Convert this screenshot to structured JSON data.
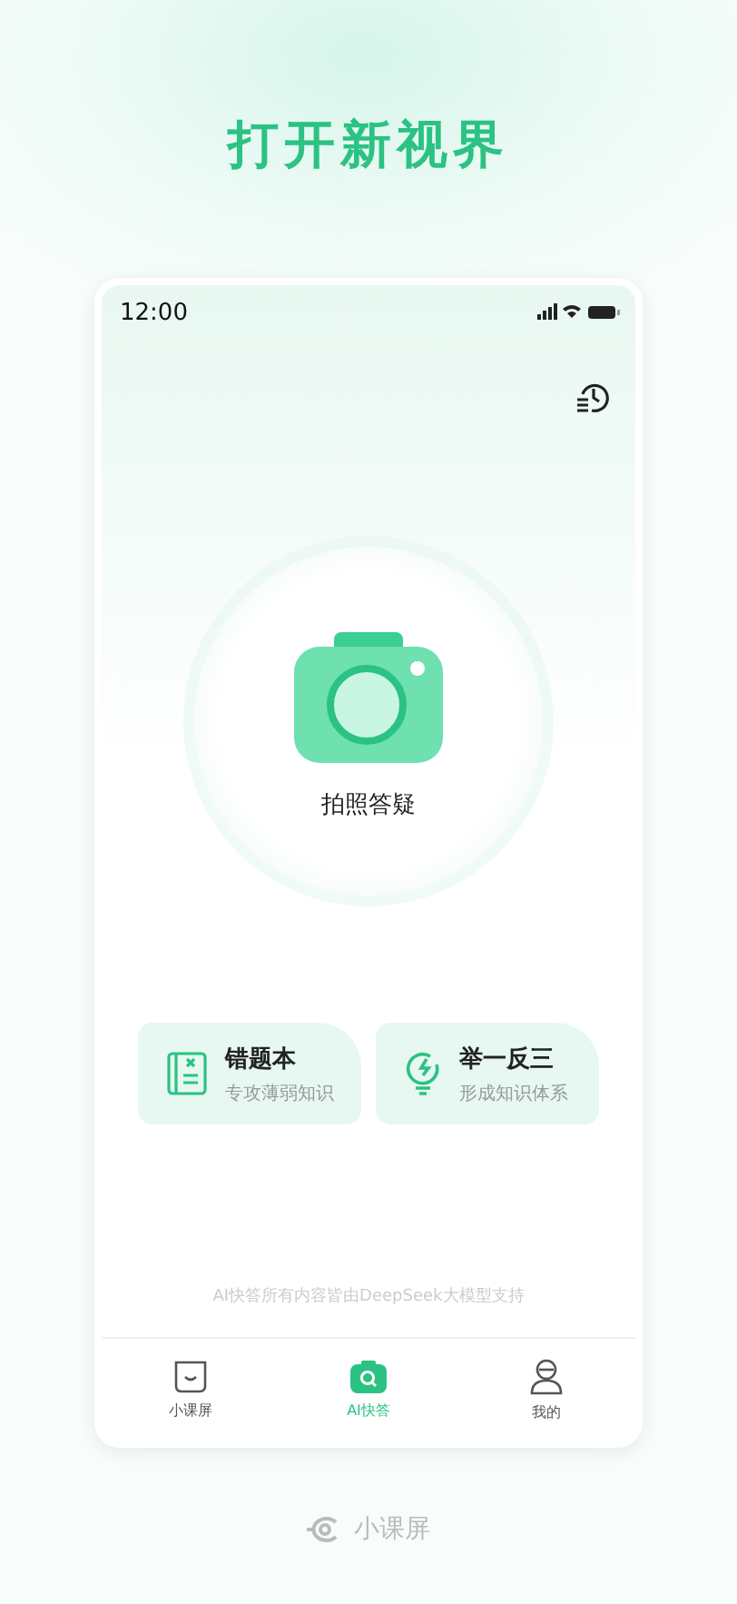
{
  "headline": "打开新视界",
  "status_bar": {
    "time": "12:00"
  },
  "camera": {
    "label": "拍照答疑"
  },
  "cards": [
    {
      "kind": "notebook",
      "title": "错题本",
      "subtitle": "专攻薄弱知识"
    },
    {
      "kind": "bulb",
      "title": "举一反三",
      "subtitle": "形成知识体系"
    }
  ],
  "disclaimer": "AI快答所有内容皆由DeepSeek大模型支持",
  "tabs": [
    {
      "kind": "screen",
      "label": "小课屏",
      "selected": false
    },
    {
      "kind": "camera",
      "label": "AI快答",
      "selected": true
    },
    {
      "kind": "profile",
      "label": "我的",
      "selected": false
    }
  ],
  "brand": "小课屏"
}
